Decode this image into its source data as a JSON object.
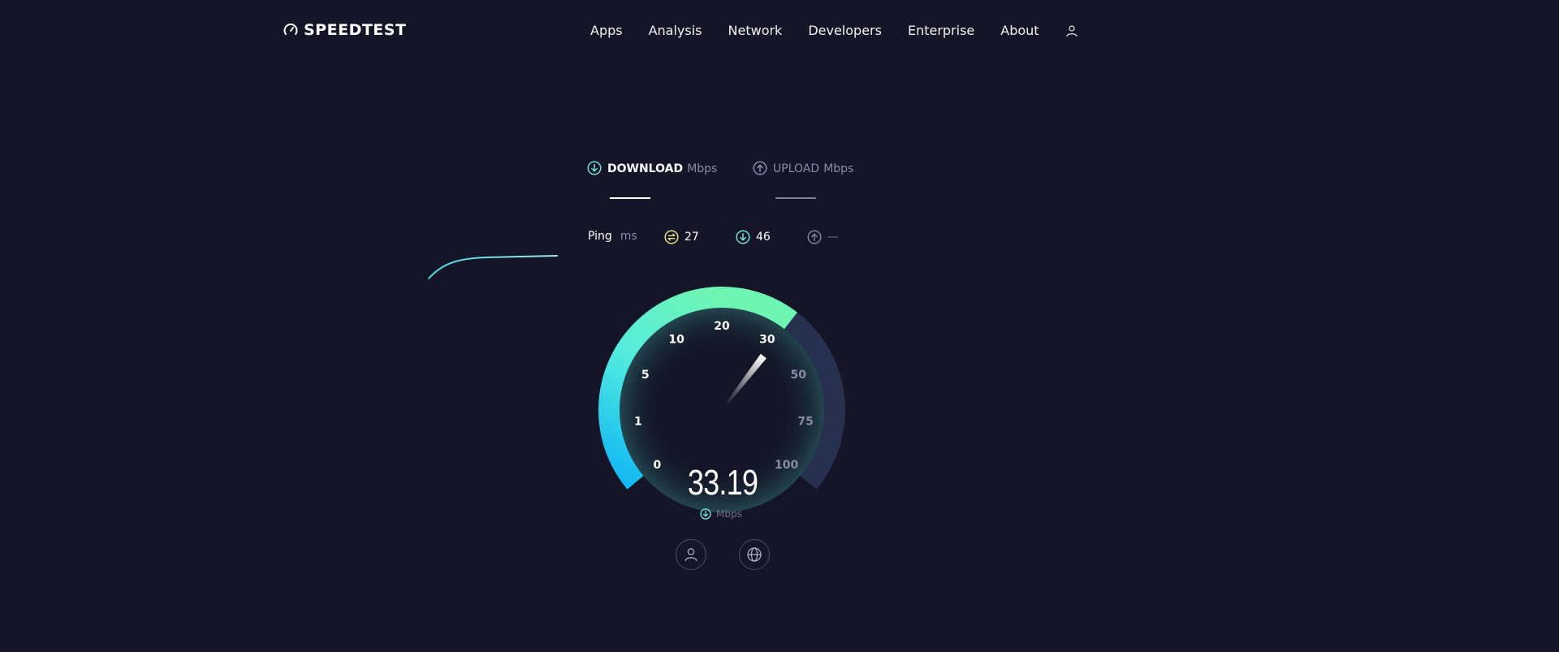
{
  "brand": {
    "name": "SPEEDTEST",
    "icon": "speedometer-icon"
  },
  "nav": {
    "items": [
      "Apps",
      "Analysis",
      "Network",
      "Developers",
      "Enterprise",
      "About"
    ],
    "user_icon": "user-icon"
  },
  "tabs": {
    "download": {
      "label": "DOWNLOAD",
      "unit": "Mbps",
      "icon": "arrow-down-circle-icon",
      "active": true
    },
    "upload": {
      "label": "UPLOAD",
      "unit": "Mbps",
      "icon": "arrow-up-circle-icon",
      "active": false
    }
  },
  "stats": {
    "ping_label": "Ping",
    "ping_unit": "ms",
    "ping_value": "27",
    "download_value": "46",
    "upload_value": "—"
  },
  "gauge": {
    "value": 33.19,
    "value_text": "33.19",
    "unit": "Mbps",
    "ticks": [
      "0",
      "1",
      "5",
      "10",
      "20",
      "30",
      "50",
      "75",
      "100"
    ],
    "tick_values": [
      0,
      1,
      5,
      10,
      20,
      30,
      50,
      75,
      100
    ]
  },
  "colors": {
    "background": "#141526",
    "accent_cyan": "#1bbdf5",
    "accent_green": "#6ff5b3",
    "ping_yellow": "#e7e08a",
    "download_teal": "#6fe3d5",
    "track": "#27304f"
  },
  "buttons": {
    "results_icon": "user-icon",
    "server_icon": "globe-icon"
  }
}
